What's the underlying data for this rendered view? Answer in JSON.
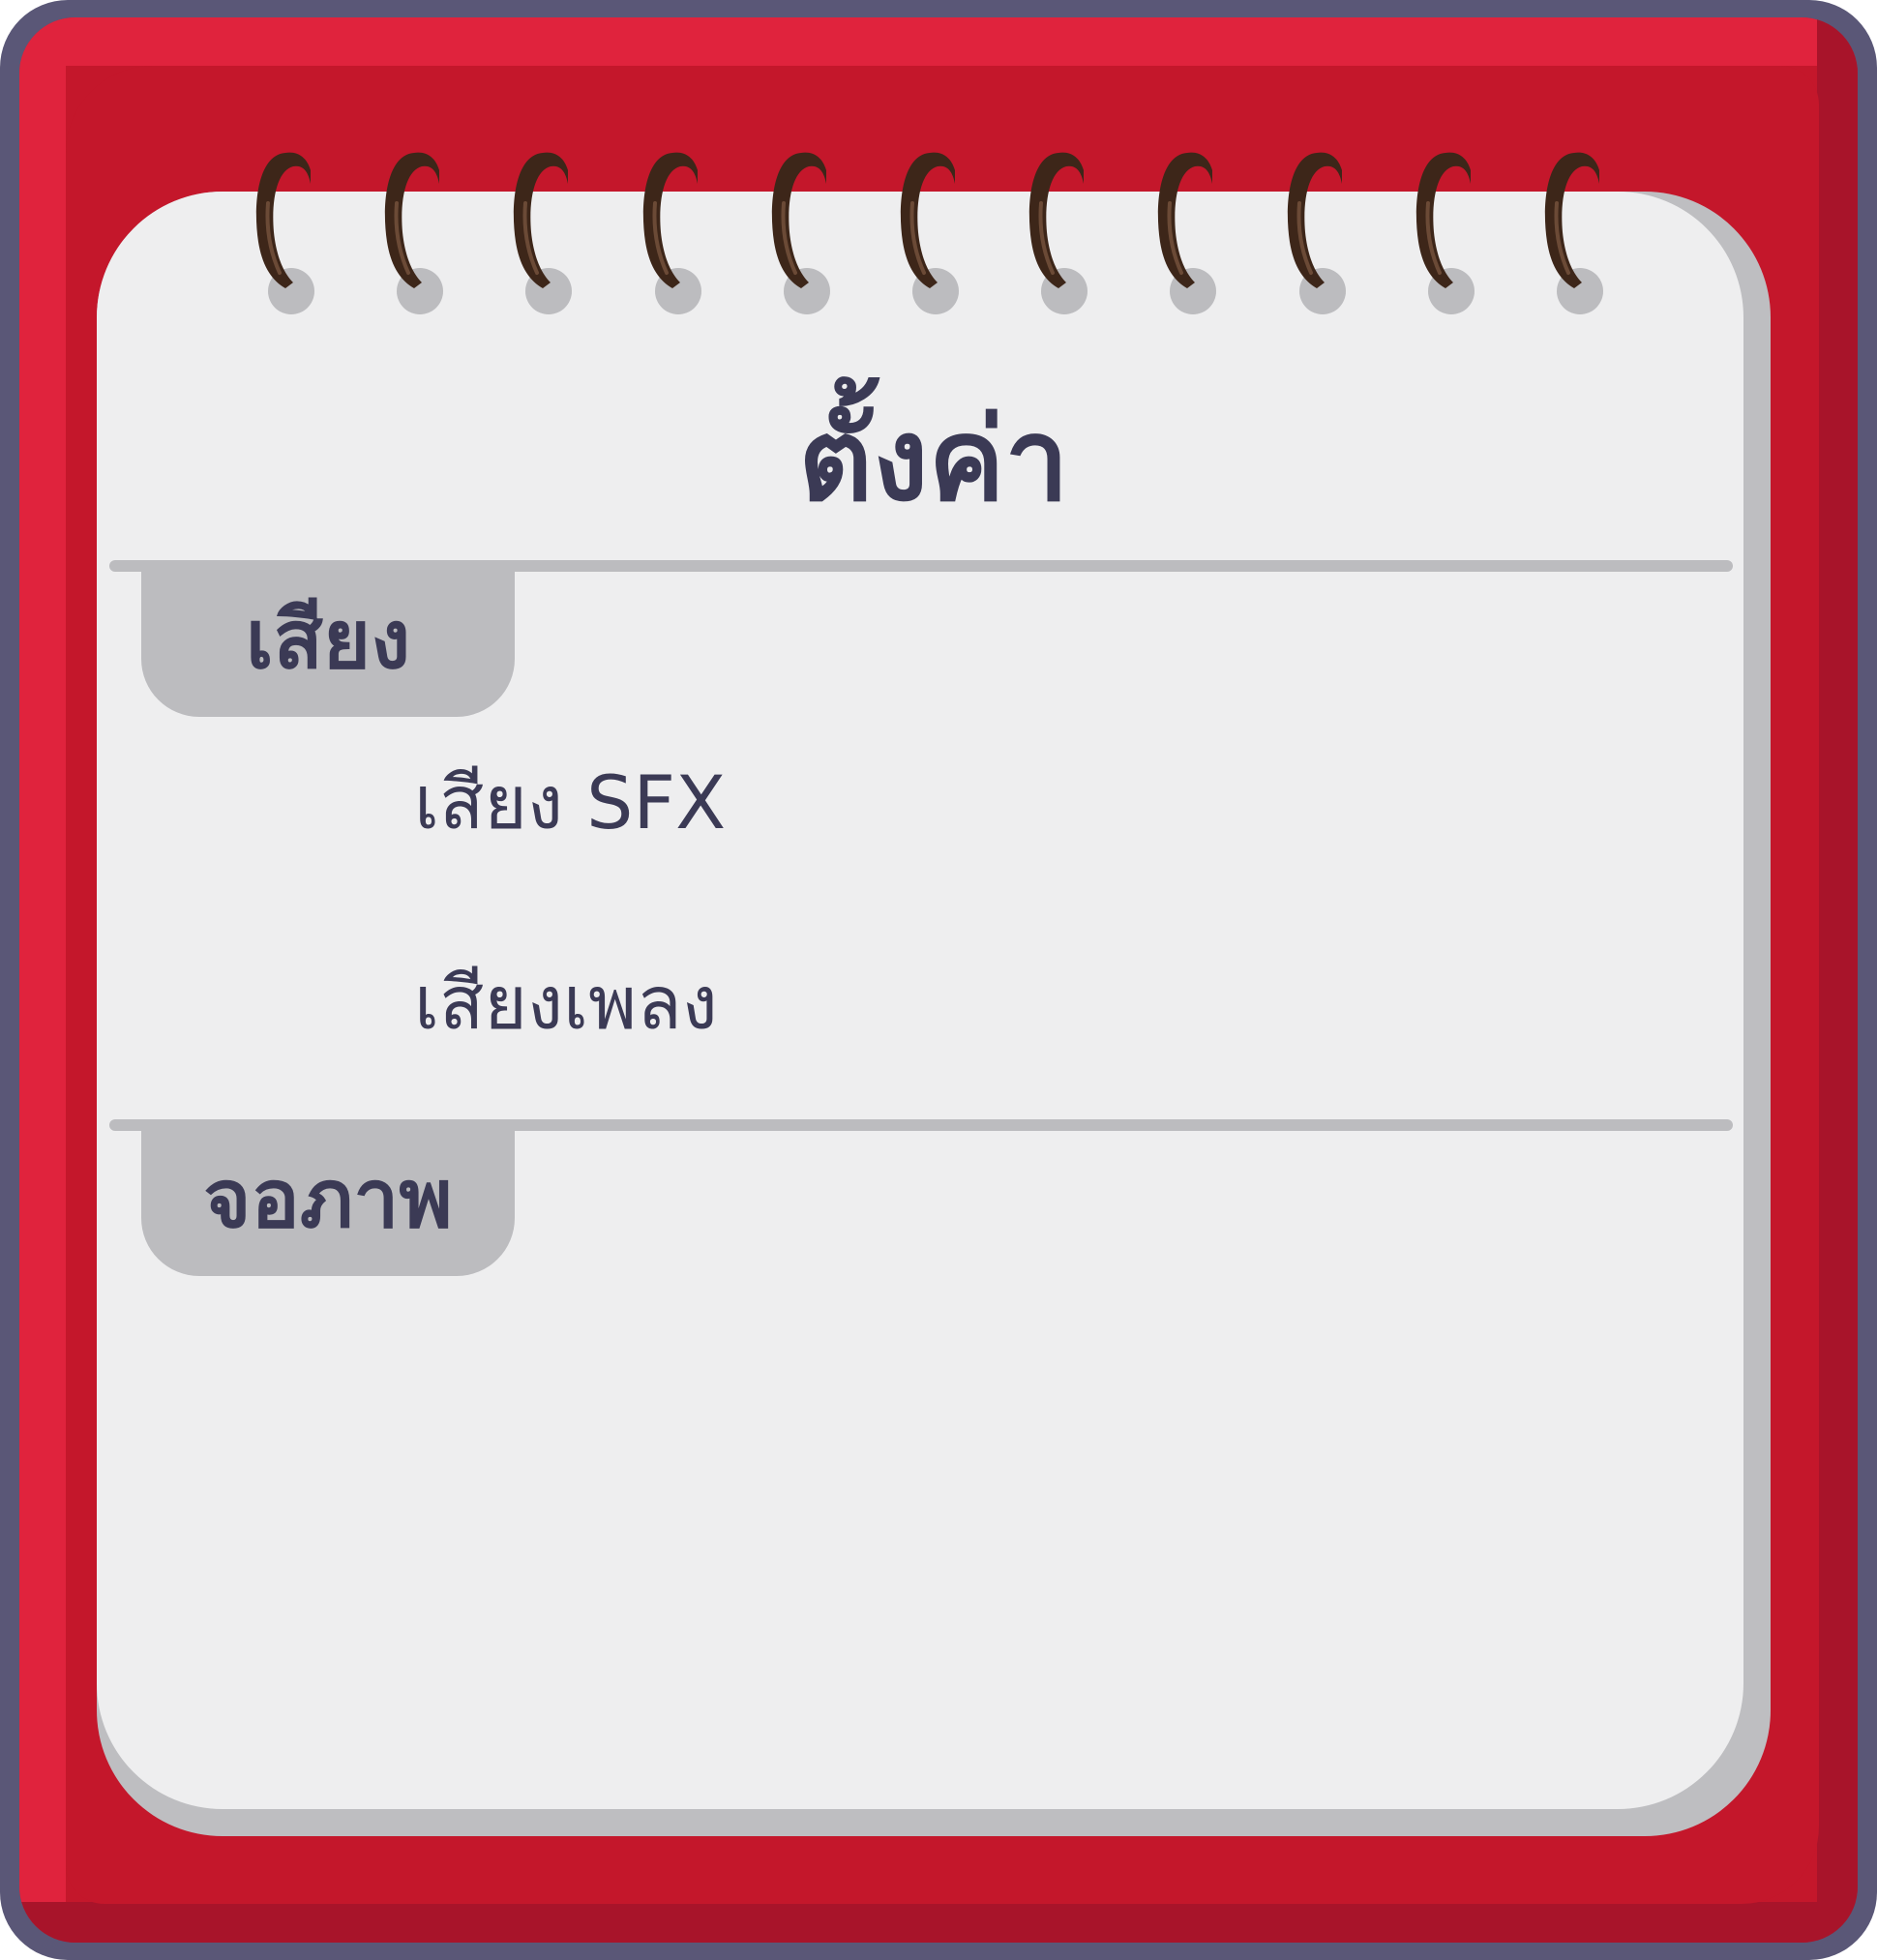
{
  "settings": {
    "title": "ตั้งค่า",
    "sections": [
      {
        "label": "เสียง",
        "options": [
          "เสียง SFX",
          "เสียงเพลง"
        ]
      },
      {
        "label": "จอภาพ",
        "options": []
      }
    ]
  },
  "colors": {
    "frame": "#5a5777",
    "cover": "#c4172b",
    "cover_highlight": "#e0233d",
    "page": "#eeeeef",
    "page_shadow": "#bebec1",
    "tab": "#bcbcbf",
    "text": "#3b3a55",
    "ring": "#3d2619"
  },
  "icons": {
    "binding_ring": "spiral-ring-icon"
  }
}
